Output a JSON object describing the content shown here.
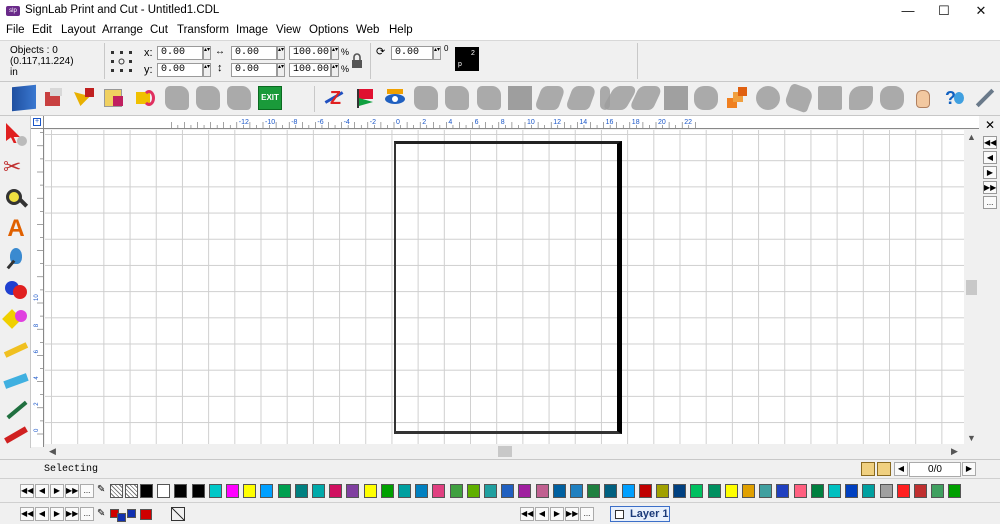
{
  "window": {
    "title": "SignLab Print and Cut - Untitled1.CDL",
    "app_icon_text": "slp",
    "minimize_glyph": "—",
    "maximize_glyph": "☐",
    "close_glyph": "✕"
  },
  "menu": [
    "File",
    "Edit",
    "Layout",
    "Arrange",
    "Cut",
    "Transform",
    "Image",
    "View",
    "Options",
    "Web",
    "Help"
  ],
  "properties": {
    "objects_label": "Objects : 0",
    "cursor_position": "(0.117,11.224)",
    "units": "in",
    "x_label": "x:",
    "y_label": "y:",
    "x_value": "0.00",
    "y_value": "0.00",
    "width_value": "0.00",
    "height_value": "0.00",
    "scale_x_value": "100.00",
    "scale_y_value": "100.00",
    "percent_sign": "%",
    "rotation_value": "0.00",
    "degree_sign": "0",
    "preview_top": "2",
    "preview_bottom": "p"
  },
  "toolbar": {
    "exit_label": "EXIT",
    "icons": [
      "page-layout-icon",
      "3d-box-icon",
      "arrow-tool-icon",
      "disk-icon",
      "rotate-object-icon",
      "shape-1-icon",
      "shape-2-icon",
      "shape-3-icon",
      "exit-sign-icon",
      "text-path-icon",
      "flag-icon",
      "eye-icon",
      "ghost-shape-icon",
      "ghost-blob-icon",
      "gray-square-icon",
      "ghost-brush-icon",
      "ghost-brush2-icon",
      "ghost-quote-icon",
      "ghost-feather-icon",
      "ghost-slash-icon",
      "gray-rect-icon",
      "ghost-cloud-icon",
      "orange-blocks-icon",
      "ghost-circle-icon",
      "ghost-leaf-icon",
      "ghost-page-icon",
      "ghost-wave-icon",
      "ghost-map-icon",
      "ghost-texture-icon",
      "hand-icon",
      "help-cursor-icon",
      "pen-icon"
    ]
  },
  "rulers": {
    "horizontal_labels": [
      "-12",
      "-10",
      "-8",
      "-6",
      "-4",
      "-2",
      "0",
      "2",
      "4",
      "6",
      "8",
      "10",
      "12",
      "14",
      "16",
      "18",
      "20",
      "22"
    ],
    "vertical_labels": [
      "10",
      "8",
      "6",
      "4",
      "2",
      "0"
    ]
  },
  "status": {
    "mode_text": "Selecting",
    "page_counter": "0/0"
  },
  "palette": {
    "nav": [
      "◀◀",
      "◀",
      "▶",
      "▶▶",
      "..."
    ],
    "colors": [
      "#000000",
      "#ffffff",
      "#000000",
      "#000000",
      "#00c8c8",
      "#ff00ff",
      "#ffff00",
      "#00a0ff",
      "#00a050",
      "#008080",
      "#00aaaa",
      "#d01060",
      "#8040a0",
      "#ffff00",
      "#00a000",
      "#00a0a0",
      "#0080c0",
      "#e04080",
      "#40a040",
      "#60b000",
      "#20a0a0",
      "#2060c0",
      "#a020a0",
      "#c06090",
      "#0060a0",
      "#2080c0",
      "#208040",
      "#006080",
      "#00a0ff",
      "#c00000",
      "#a0a000",
      "#004080",
      "#00c060",
      "#009060",
      "#ffff00",
      "#e0a000",
      "#40a0a0",
      "#2040c0",
      "#ff6080",
      "#008040",
      "#00c0c0",
      "#0040c0",
      "#00a0a0",
      "#a0a0a0",
      "#ff2020",
      "#c03030",
      "#40a060",
      "#00a000"
    ]
  },
  "layers": {
    "nav": [
      "◀◀",
      "◀",
      "▶",
      "▶▶",
      "..."
    ],
    "layer_label": "Layer 1",
    "bottom_nav": [
      "◀◀",
      "◀",
      "▶",
      "▶▶",
      "..."
    ]
  }
}
